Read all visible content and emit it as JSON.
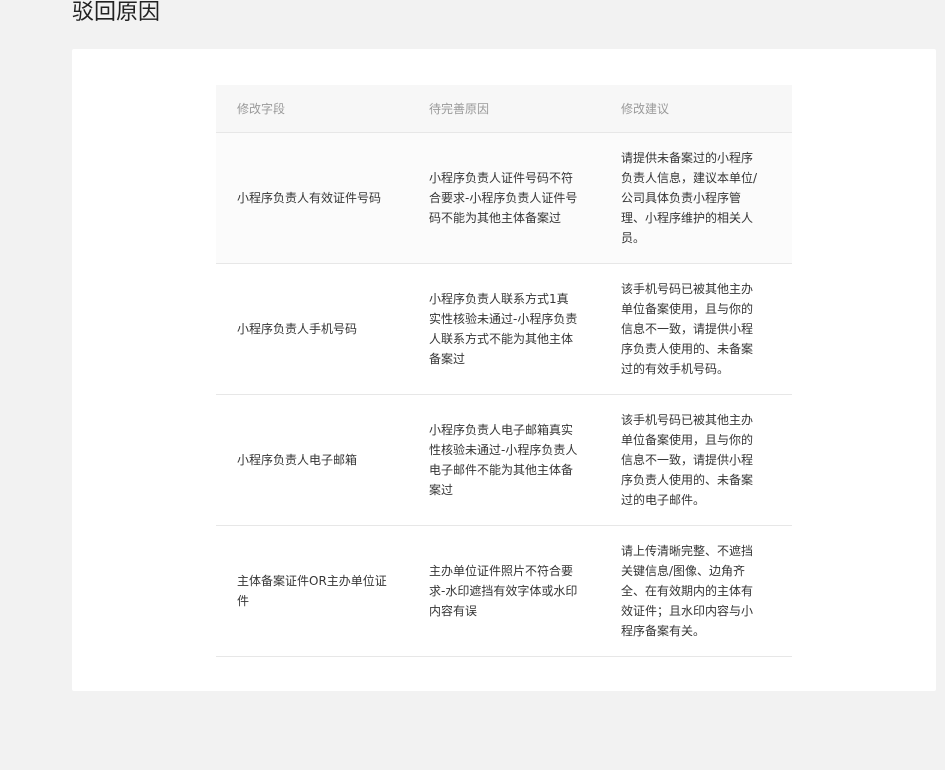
{
  "page": {
    "title": "驳回原因"
  },
  "table": {
    "headers": [
      "修改字段",
      "待完善原因",
      "修改建议"
    ],
    "rows": [
      {
        "field": "小程序负责人有效证件号码",
        "reason": "小程序负责人证件号码不符合要求-小程序负责人证件号码不能为其他主体备案过",
        "suggestion": "请提供未备案过的小程序负责人信息，建议本单位/公司具体负责小程序管理、小程序维护的相关人员。"
      },
      {
        "field": "小程序负责人手机号码",
        "reason": "小程序负责人联系方式1真实性核验未通过-小程序负责人联系方式不能为其他主体备案过",
        "suggestion": "该手机号码已被其他主办单位备案使用，且与你的信息不一致，请提供小程序负责人使用的、未备案过的有效手机号码。"
      },
      {
        "field": "小程序负责人电子邮箱",
        "reason": "小程序负责人电子邮箱真实性核验未通过-小程序负责人电子邮件不能为其他主体备案过",
        "suggestion": "该手机号码已被其他主办单位备案使用，且与你的信息不一致，请提供小程序负责人使用的、未备案过的电子邮件。"
      },
      {
        "field": "主体备案证件OR主办单位证件",
        "reason": "主办单位证件照片不符合要求-水印遮挡有效字体或水印内容有误",
        "suggestion": "请上传清晰完整、不遮挡关键信息/图像、边角齐全、在有效期内的主体有效证件；且水印内容与小程序备案有关。"
      }
    ]
  }
}
